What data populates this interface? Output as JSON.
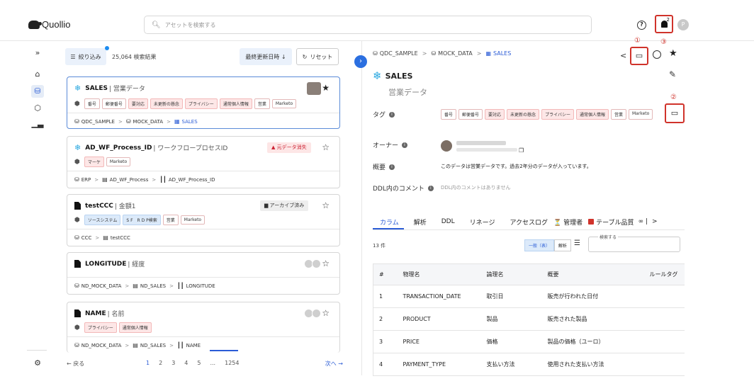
{
  "header": {
    "logo_text": "Quollio",
    "search_placeholder": "アセットを検索する",
    "help_glyph": "?",
    "notification_count": "2",
    "avatar_initial": "P"
  },
  "list": {
    "filter_label": "絞り込み",
    "result_count": "25,064 検索結果",
    "sort_label": "最終更新日時 ↓",
    "reset_label": "リセット",
    "cards": [
      {
        "name": "SALES",
        "sub": "| 営業データ",
        "tags": [
          "番号",
          "郵便番号",
          "要対応",
          "未更新の懸念",
          "プライバシー",
          "通常個人情報",
          "営業",
          "Marketo"
        ],
        "path": [
          "QDC_SAMPLE",
          "MOCK_DATA",
          "SALES"
        ]
      },
      {
        "name": "AD_WF_Process_ID",
        "sub": "| ワークフロープロセスID",
        "badge": "元データ消失",
        "tags": [
          "マーケ",
          "Marketo"
        ],
        "path": [
          "ERP",
          "AD_WF_Process",
          "AD_WF_Process_ID"
        ]
      },
      {
        "name": "testCCC",
        "sub": "| 金額1",
        "badge": "アーカイブ済み",
        "tags": [
          "ソースシステム",
          "S F　R D P検索",
          "営業",
          "Marketo"
        ],
        "path": [
          "CCC",
          "testCCC"
        ]
      },
      {
        "name": "LONGITUDE",
        "sub": "| 経度",
        "path": [
          "ND_MOCK_DATA",
          "ND_SALES",
          "LONGITUDE"
        ]
      },
      {
        "name": "NAME",
        "sub": "| 名前",
        "tags": [
          "プライバシー",
          "通常個人情報"
        ],
        "path": [
          "ND_MOCK_DATA",
          "ND_SALES",
          "NAME"
        ]
      }
    ],
    "pager": {
      "back": "← 戻る",
      "pages": [
        "1",
        "2",
        "3",
        "4",
        "5",
        "...",
        "1254"
      ],
      "next": "次へ →"
    }
  },
  "detail": {
    "breadcrumb": [
      "QDC_SAMPLE",
      "MOCK_DATA",
      "SALES"
    ],
    "title": "SALES",
    "subtitle": "営業データ",
    "labels": {
      "tags": "タグ",
      "owner": "オーナー",
      "summary": "概要",
      "ddl_comment": "DDL内のコメント"
    },
    "tags": [
      "番号",
      "郵便番号",
      "要対応",
      "未更新の懸念",
      "プライバシー",
      "通常個人情報",
      "営業",
      "Marketo"
    ],
    "summary_text": "このデータは営業データです。過去2年分のデータが入っています。",
    "ddl_text": "DDL内のコメントはありません",
    "annotations": [
      "①",
      "②",
      "③"
    ],
    "tabs": [
      "カラム",
      "解析",
      "DDL",
      "リネージ",
      "アクセスログ",
      "⏳ 管理者",
      "テーブル品質",
      "∞ |",
      ">"
    ],
    "column_count": "13 件",
    "segments": [
      "一般（表）",
      "解析"
    ],
    "column_search_label": "検索する",
    "table": {
      "headers": [
        "#",
        "物理名",
        "論理名",
        "概要",
        "ルールタグ"
      ],
      "rows": [
        [
          "1",
          "TRANSACTION_DATE",
          "取引日",
          "販売が行われた日付",
          ""
        ],
        [
          "2",
          "PRODUCT",
          "製品",
          "販売された製品",
          ""
        ],
        [
          "3",
          "PRICE",
          "価格",
          "製品の価格（ユーロ）",
          ""
        ],
        [
          "4",
          "PAYMENT_TYPE",
          "支払い方法",
          "使用された支払い方法",
          ""
        ]
      ]
    }
  }
}
